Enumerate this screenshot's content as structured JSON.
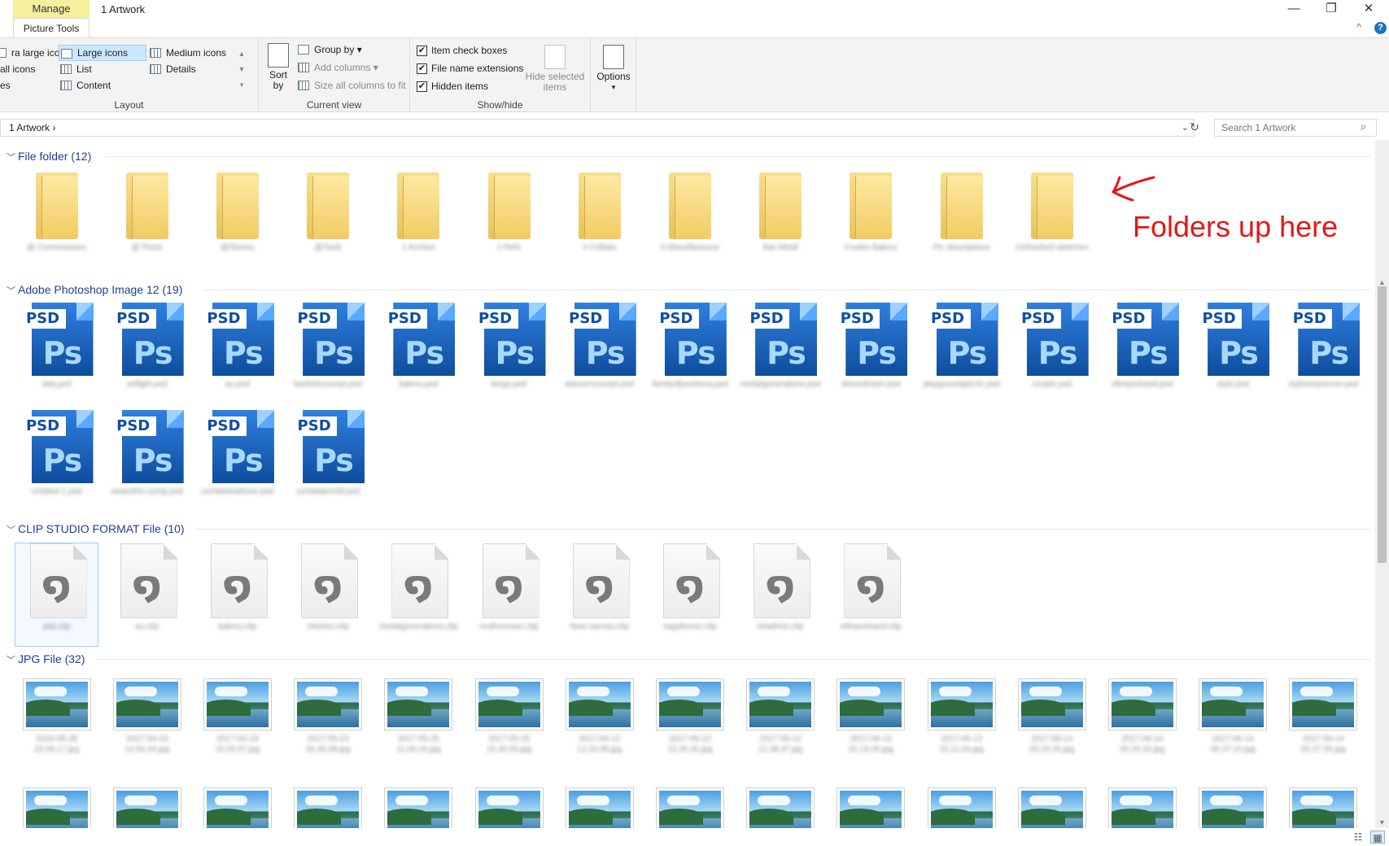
{
  "window": {
    "title": "1 Artwork",
    "context_tab": "Manage",
    "context_subtab": "Picture Tools",
    "minimize": "—",
    "restore": "❐",
    "close": "✕",
    "collapse": "^",
    "help": "?"
  },
  "ribbon": {
    "layout": {
      "label": "Layout",
      "items": [
        {
          "label": "ra large icons"
        },
        {
          "label": "Large icons"
        },
        {
          "label": "Medium icons"
        },
        {
          "label": "all icons"
        },
        {
          "label": "List"
        },
        {
          "label": "Details"
        },
        {
          "label": "es"
        },
        {
          "label": "Content"
        }
      ]
    },
    "current_view": {
      "label": "Current view",
      "sort": "Sort\nby",
      "group_by": "Group by ▾",
      "add_columns": "Add columns ▾",
      "size_columns": "Size all columns to fit"
    },
    "show_hide": {
      "label": "Show/hide",
      "item_check_boxes": "Item check boxes",
      "file_name_extensions": "File name extensions",
      "hidden_items": "Hidden items",
      "hide_selected": "Hide selected items",
      "check": "✔"
    },
    "options": "Options"
  },
  "address": {
    "path": "1 Artwork",
    "sep": "›",
    "dropdown": "⌄",
    "refresh": "↻",
    "search_placeholder": "Search 1 Artwork",
    "search_icon": "⌕"
  },
  "sections": {
    "folders": {
      "title": "File folder (12)",
      "count": 12,
      "labels": [
        "@ Commissions",
        "@ Prints",
        "@Stories",
        "@Tools",
        "1 Archive",
        "2 Refs",
        "4 Collabs",
        "5 Miscellaneous",
        "Ask Metal",
        "Cookie Bakery",
        "Pic descriptions",
        "Unfinished sketches"
      ]
    },
    "psd": {
      "title": "Adobe Photoshop Image 12 (19)",
      "tag": "PSD",
      "ps": "Ps",
      "labels": [
        "ada.psd",
        "artfight.psd",
        "au.psd",
        "banbelconcept.psd",
        "bakery.psd",
        "bingo.psd",
        "dancerconcept.psd",
        "familyofjoestiona.psd",
        "medalgenerations.psd",
        "Moondream.psd",
        "playgroundpicnic.psd",
        "couple.psd",
        "ellmposhand.psd",
        "style.psd",
        "stylesequencer.psd",
        "Untitled-1.psd",
        "wearethe-cyndy.psd",
        "zombielowthree.psd",
        "zombiejennfd.psd"
      ]
    },
    "clip": {
      "title": "CLIP STUDIO FORMAT File (10)",
      "glyph": "໑",
      "labels": [
        "ada.clip",
        "au.clip",
        "bakery.clip",
        "chicken.clip",
        "medalgenerations.clip",
        "mothecrown.clip",
        "New canvas.clip",
        "sagaforme.clip",
        "shadrton.clip",
        "ellmposhand.clip"
      ]
    },
    "jpg": {
      "title": "JPG File (32)",
      "labels": [
        "2016-08-28 23.09.17.jpg",
        "2017-04-19 14.54.34.jpg",
        "2017-04-19 15.03.57.jpg",
        "2017-05-23 16.45.09.jpg",
        "2017-05-25 11.09.16.jpg",
        "2017-05-25 15.30.59.jpg",
        "2017-06-12 12.33.35.jpg",
        "2017-06-12 12.35.32.jpg",
        "2017-06-12 12.38.47.jpg",
        "2017-06-13 22.19.05.jpg",
        "2017-06-13 22.11.04.jpg",
        "2017-06-14 00.25.25.jpg",
        "2017-06-14 00.25.32.jpg",
        "2017-06-14 00.27.10.jpg",
        "2017-06-14 00.27.25.jpg"
      ]
    }
  },
  "annotation": {
    "text": "Folders up here",
    "color": "#e11818"
  },
  "status": {
    "details_view": "☷",
    "large_view": "▦"
  },
  "colors": {
    "accent": "#1f3f91",
    "selection": "#cce8ff",
    "context_tab": "#f6ef9e"
  }
}
